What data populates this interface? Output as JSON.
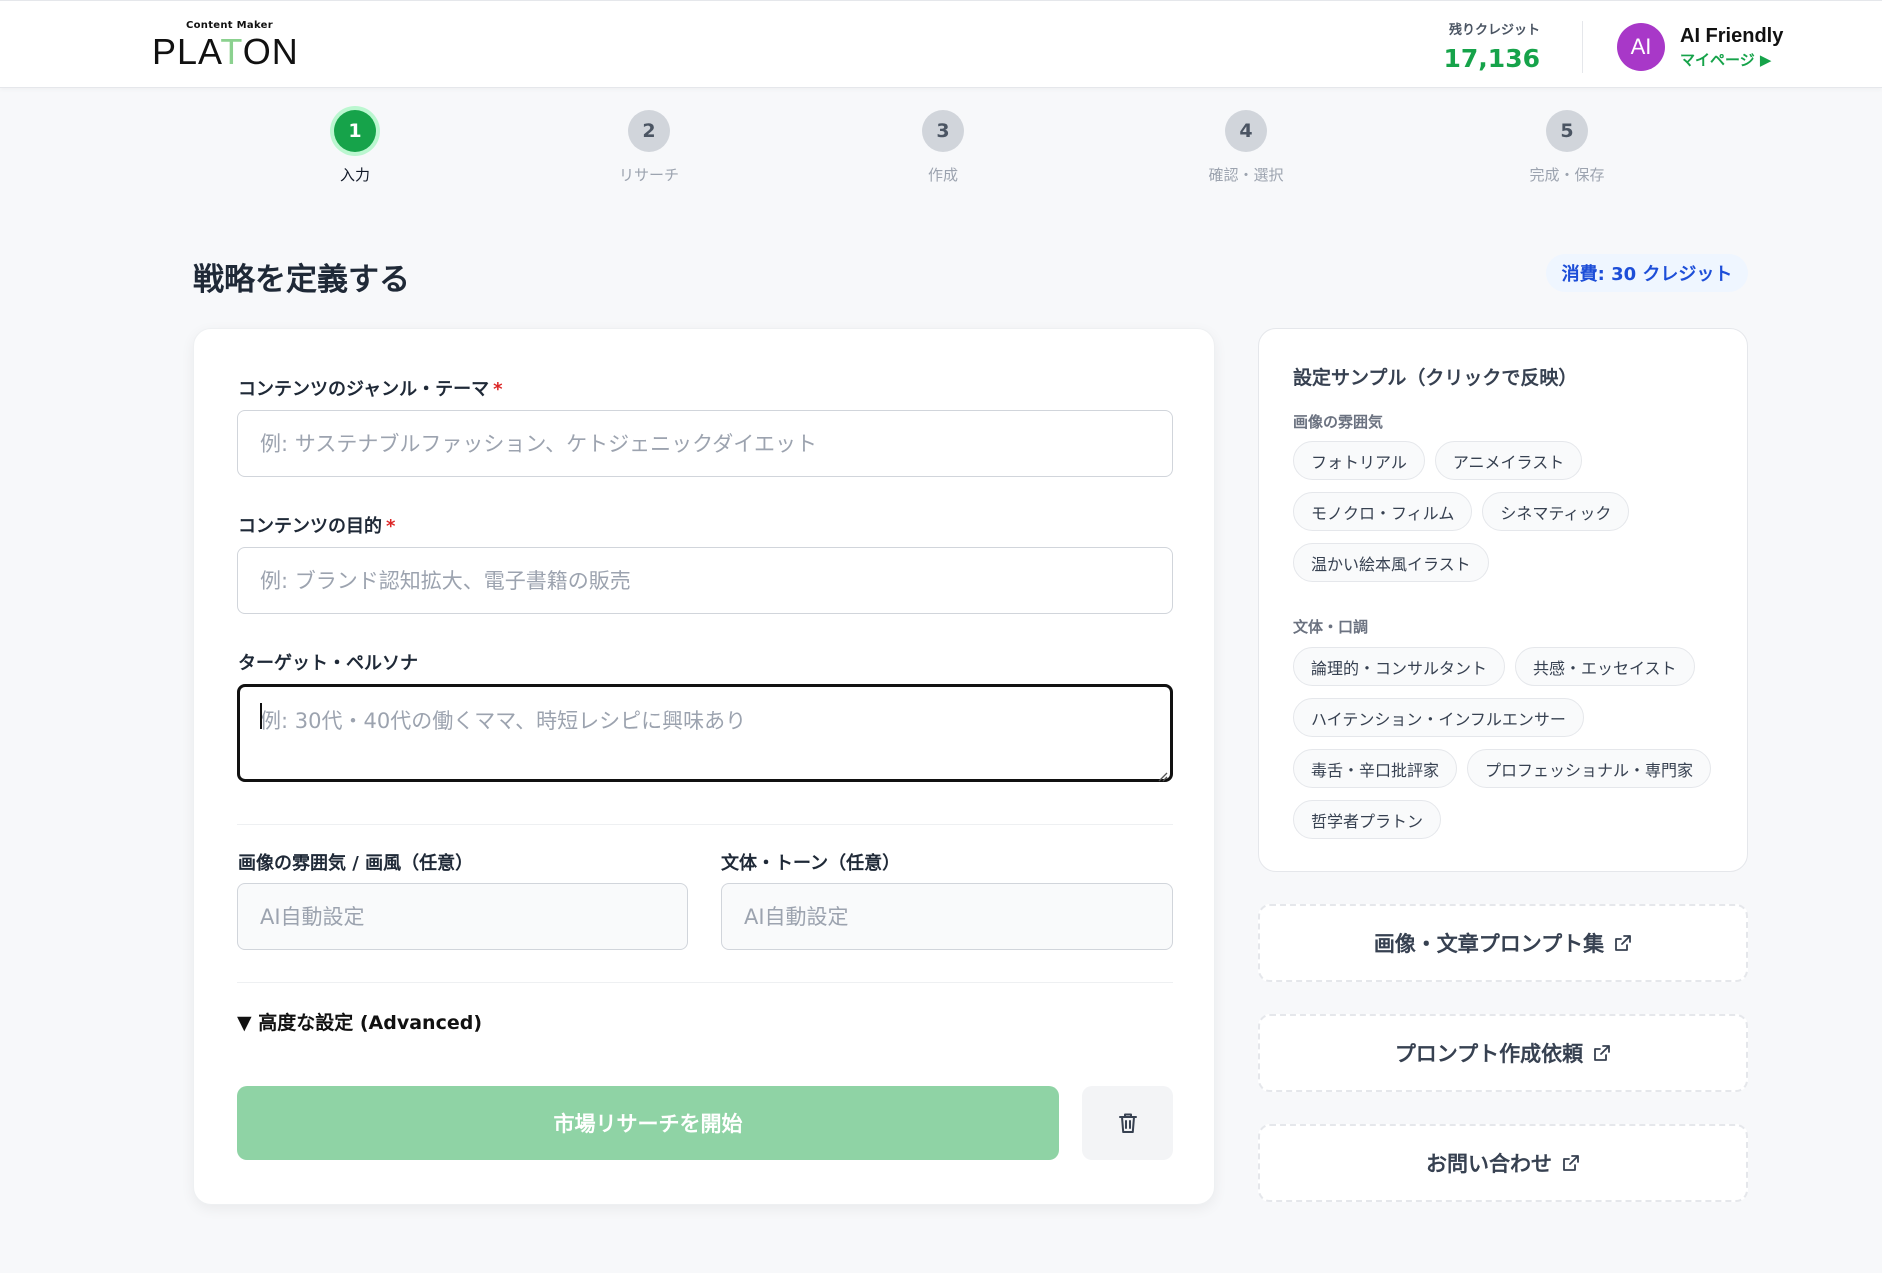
{
  "header": {
    "logo_small": "Content Maker",
    "logo_part1": "PLA",
    "logo_accent": "T",
    "logo_part2": "ON",
    "credit_label": "残りクレジット",
    "credit_value": "17,136",
    "avatar_initials": "AI",
    "user_name": "AI Friendly",
    "mypage_label": "マイページ ▶"
  },
  "steps": [
    {
      "number": "1",
      "label": "入力",
      "active": true
    },
    {
      "number": "2",
      "label": "リサーチ",
      "active": false
    },
    {
      "number": "3",
      "label": "作成",
      "active": false
    },
    {
      "number": "4",
      "label": "確認・選択",
      "active": false
    },
    {
      "number": "5",
      "label": "完成・保存",
      "active": false
    }
  ],
  "page": {
    "title": "戦略を定義する",
    "cost_badge": "消費: 30 クレジット"
  },
  "form": {
    "theme_label": "コンテンツのジャンル・テーマ",
    "theme_placeholder": "例: サステナブルファッション、ケトジェニックダイエット",
    "purpose_label": "コンテンツの目的",
    "purpose_placeholder": "例: ブランド認知拡大、電子書籍の販売",
    "persona_label": "ターゲット・ペルソナ",
    "persona_placeholder": "例: 30代・40代の働くママ、時短レシピに興味あり",
    "image_style_label": "画像の雰囲気 / 画風（任意）",
    "image_style_placeholder": "AI自動設定",
    "tone_label": "文体・トーン（任意）",
    "tone_placeholder": "AI自動設定",
    "required_mark": "*",
    "advanced_label": "▼ 高度な設定 (Advanced)",
    "start_button": "市場リサーチを開始"
  },
  "samples": {
    "title": "設定サンプル（クリックで反映）",
    "image_group_label": "画像の雰囲気",
    "image_chips": [
      "フォトリアル",
      "アニメイラスト",
      "モノクロ・フィルム",
      "シネマティック",
      "温かい絵本風イラスト"
    ],
    "tone_group_label": "文体・口調",
    "tone_chips": [
      "論理的・コンサルタント",
      "共感・エッセイスト",
      "ハイテンション・インフルエンサー",
      "毒舌・辛口批評家",
      "プロフェッショナル・専門家",
      "哲学者プラトン"
    ]
  },
  "links": {
    "prompt_collection": "画像・文章プロンプト集",
    "prompt_request": "プロンプト作成依頼",
    "contact": "お問い合わせ"
  },
  "colors": {
    "accent_green": "#16a34a",
    "button_green": "#8fd3a5",
    "badge_blue": "#1d4ed8",
    "avatar_purple": "#a838c8"
  }
}
